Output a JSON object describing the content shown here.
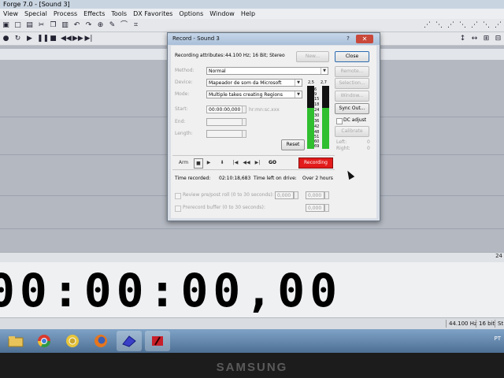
{
  "app": {
    "title": "Forge 7.0 - [Sound 3]",
    "menu": [
      "View",
      "Special",
      "Process",
      "Effects",
      "Tools",
      "DX Favorites",
      "Options",
      "Window",
      "Help"
    ]
  },
  "timecode": "00:00:00,00",
  "ruler_value": "24",
  "status": {
    "sample_rate": "44.100 Hz",
    "bits": "16 bit",
    "tail": "St"
  },
  "dialog": {
    "title": "Record - Sound 3",
    "help_label": "?",
    "close_x": "✕",
    "attributes_label": "Recording attributes:",
    "attributes_value": "44.100 Hz; 16 Bit; Stereo",
    "new_label": "New...",
    "close_label": "Close",
    "method_label": "Method:",
    "method_value": "Normal",
    "device_label": "Device:",
    "device_value": "Mapeador de som da Microsoft",
    "mode_label": "Mode:",
    "mode_value": "Multiple takes creating Regions",
    "start_label": "Start:",
    "start_value": "00:00:00,000",
    "start_format": "hr:mn:sc.xxx",
    "end_label": "End:",
    "length_label": "Length:",
    "reset_label": "Reset",
    "meter_top": [
      "2,5",
      "2,7"
    ],
    "meter_scale": [
      "6",
      "9",
      "15",
      "18",
      "24",
      "30",
      "36",
      "42",
      "48",
      "51",
      "60",
      "69"
    ],
    "side_buttons": [
      "Remote...",
      "Selection...",
      "Window..."
    ],
    "sync_label": "Sync Out...",
    "dc_adjust_label": "DC adjust",
    "calibrate_label": "Calibrate",
    "left_label": "Left:",
    "left_value": "0",
    "right_label": "Right:",
    "right_value": "0",
    "arm_label": "Arm",
    "go_label": "GO",
    "recording_label": "Recording",
    "time_recorded_label": "Time recorded:",
    "time_recorded_value": "02:10:18,683",
    "time_left_label": "Time left on drive:",
    "time_left_value": "Over 2 hours",
    "preroll_label": "Review pre/post roll (0 to 30 seconds):",
    "preroll_val1": "0,000",
    "preroll_val2": "0,000",
    "prerecord_label": "Prerecord buffer (0 to 30 seconds):",
    "prerecord_val": "0,000"
  },
  "taskbar": {
    "items": [
      "windows-explorer",
      "chrome",
      "chrome-alt",
      "firefox",
      "sound-forge",
      "other-app"
    ],
    "tray": "PT"
  },
  "bezel": "SAMSUNG"
}
